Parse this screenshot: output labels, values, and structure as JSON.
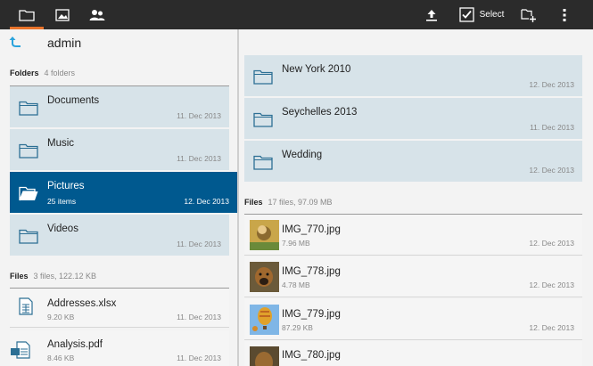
{
  "topbar": {
    "tabs": [
      {
        "icon": "folder-icon",
        "active": true
      },
      {
        "icon": "image-icon",
        "active": false
      },
      {
        "icon": "people-icon",
        "active": false
      }
    ],
    "select_label": "Select",
    "accent": "#e8732b"
  },
  "left": {
    "path_title": "admin",
    "folders_label": "Folders",
    "folders_count": "4 folders",
    "folders": [
      {
        "name": "Documents",
        "date": "11. Dec 2013"
      },
      {
        "name": "Music",
        "date": "11. Dec 2013"
      },
      {
        "name": "Pictures",
        "sub": "25 items",
        "date": "12. Dec 2013",
        "selected": true
      },
      {
        "name": "Videos",
        "date": "11. Dec 2013"
      }
    ],
    "files_label": "Files",
    "files_count": "3 files, 122.12 KB",
    "files": [
      {
        "name": "Addresses.xlsx",
        "size": "9.20 KB",
        "date": "11. Dec 2013",
        "icon": "spreadsheet-icon"
      },
      {
        "name": "Analysis.pdf",
        "size": "8.46 KB",
        "date": "11. Dec 2013",
        "icon": "pdf-icon"
      }
    ]
  },
  "right": {
    "folders": [
      {
        "name": "New York 2010",
        "date": "12. Dec 2013"
      },
      {
        "name": "Seychelles 2013",
        "date": "11. Dec 2013"
      },
      {
        "name": "Wedding",
        "date": "12. Dec 2013"
      }
    ],
    "files_label": "Files",
    "files_count": "17 files, 97.09 MB",
    "files": [
      {
        "name": "IMG_770.jpg",
        "size": "7.96 MB",
        "date": "12. Dec 2013"
      },
      {
        "name": "IMG_778.jpg",
        "size": "4.78 MB",
        "date": "12. Dec 2013"
      },
      {
        "name": "IMG_779.jpg",
        "size": "87.29 KB",
        "date": "12. Dec 2013"
      },
      {
        "name": "IMG_780.jpg",
        "size": "",
        "date": ""
      }
    ]
  },
  "colors": {
    "selected": "#00598f",
    "card": "#d7e3e9",
    "link_blue": "#2aa3dc"
  }
}
